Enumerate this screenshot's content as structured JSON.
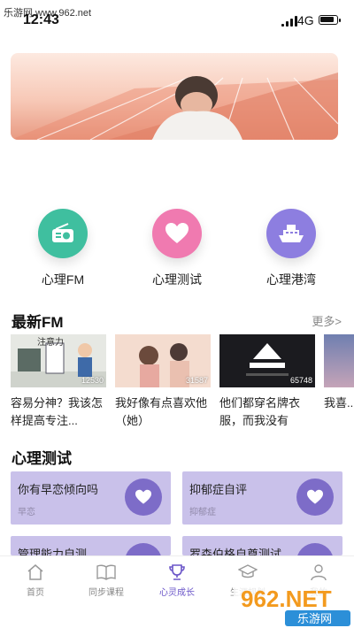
{
  "watermark": "乐游网 www.962.net",
  "status": {
    "time": "12:43",
    "network": "4G"
  },
  "quick_actions": [
    {
      "label": "心理FM",
      "icon": "radio-icon",
      "color": "#3fbf9f"
    },
    {
      "label": "心理测试",
      "icon": "heart-icon",
      "color": "#f07ab0"
    },
    {
      "label": "心理港湾",
      "icon": "ship-icon",
      "color": "#8d7ee0"
    }
  ],
  "fm_section": {
    "title": "最新FM",
    "more": "更多>",
    "items": [
      {
        "title": "容易分神？我该怎样提高专注...",
        "count": "12530",
        "thumb_text": "注意力"
      },
      {
        "title": "我好像有点喜欢他（她）",
        "count": "31587"
      },
      {
        "title": "他们都穿名牌衣服，而我没有",
        "count": "65748"
      },
      {
        "title": "我喜...",
        "count": ""
      }
    ]
  },
  "test_section": {
    "title": "心理测试",
    "cards": [
      {
        "title": "你有早恋倾向吗",
        "sub": "早恋"
      },
      {
        "title": "抑郁症自评",
        "sub": "抑郁症"
      },
      {
        "title": "管理能力自测",
        "sub": ""
      },
      {
        "title": "罗森伯格自尊测试",
        "sub": ""
      }
    ]
  },
  "tabbar": [
    {
      "label": "首页",
      "icon": "home-icon"
    },
    {
      "label": "同步课程",
      "icon": "book-icon"
    },
    {
      "label": "心灵成长",
      "icon": "trophy-icon",
      "active": true
    },
    {
      "label": "生涯规划",
      "icon": "graduation-cap-icon"
    },
    {
      "label": "我的",
      "icon": "user-icon"
    }
  ],
  "logo": {
    "brand": "962.NET",
    "sub": "乐游网"
  },
  "colors": {
    "accent": "#6a55c8",
    "card": "#c9c1ea"
  }
}
